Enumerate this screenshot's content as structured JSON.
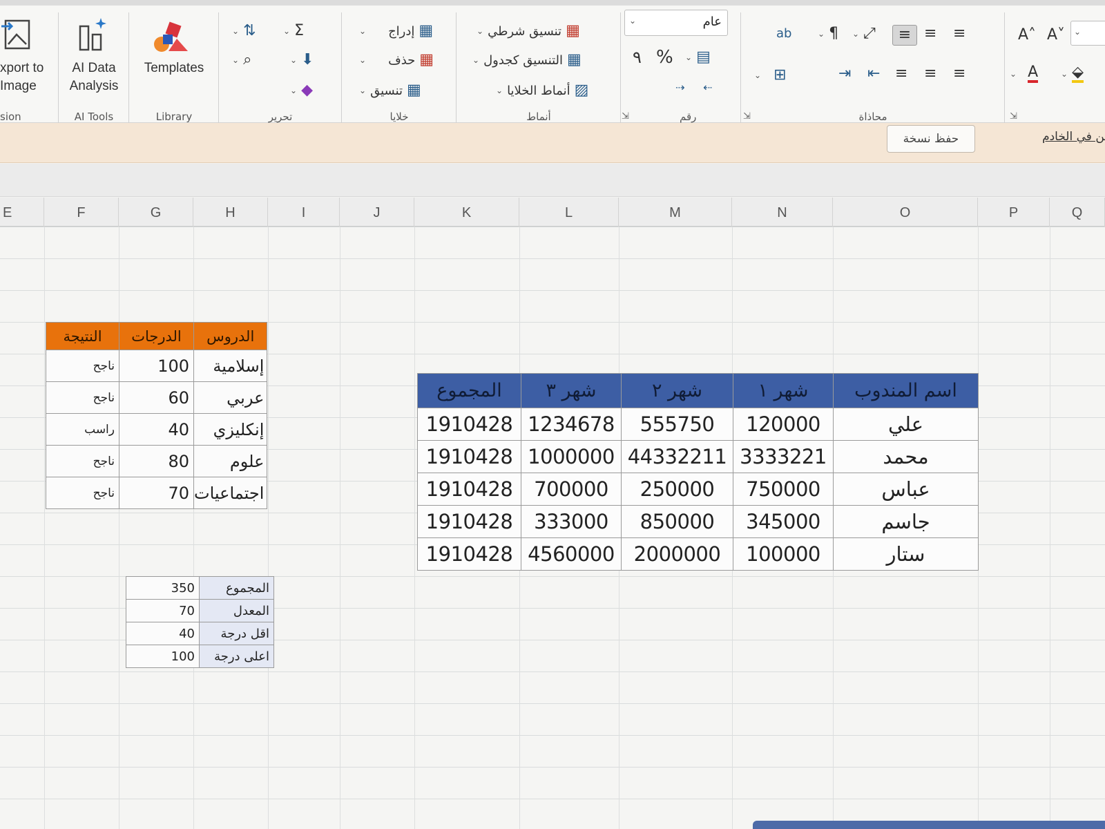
{
  "ribbon": {
    "export": {
      "label_line1": "xport to",
      "label_line2": "Image",
      "group": "sion"
    },
    "ai": {
      "label_line1": "AI Data",
      "label_line2": "Analysis",
      "group": "AI Tools"
    },
    "library": {
      "label": "Templates",
      "group": "Library"
    },
    "editing": {
      "group": "تحرير"
    },
    "cells": {
      "group": "خلايا",
      "insert": "إدراج",
      "delete": "حذف",
      "format": "تنسيق"
    },
    "styles": {
      "group": "أنماط",
      "conditional": "تنسيق شرطي",
      "as_table": "التنسيق كجدول",
      "cell_styles": "أنماط الخلايا"
    },
    "number": {
      "group": "رقم",
      "format_value": "عام",
      "percent": "%",
      "comma": "٩"
    },
    "alignment": {
      "group": "محاذاة"
    }
  },
  "infobar": {
    "save_copy": "حفظ نسخة",
    "text": "ة للتخزين في الخادم."
  },
  "columns": [
    "E",
    "F",
    "G",
    "H",
    "I",
    "J",
    "K",
    "L",
    "M",
    "N",
    "O",
    "P",
    "Q"
  ],
  "grades_table": {
    "headers": {
      "subject": "الدروس",
      "grade": "الدرجات",
      "result": "النتيجة"
    },
    "rows": [
      {
        "subject": "إسلامية",
        "grade": "100",
        "result": "ناجح"
      },
      {
        "subject": "عربي",
        "grade": "60",
        "result": "ناجح"
      },
      {
        "subject": "إنكليزي",
        "grade": "40",
        "result": "راسب"
      },
      {
        "subject": "علوم",
        "grade": "80",
        "result": "ناجح"
      },
      {
        "subject": "اجتماعيات",
        "grade": "70",
        "result": "ناجح"
      }
    ]
  },
  "stats_table": {
    "rows": [
      {
        "label": "المجموع",
        "value": "350"
      },
      {
        "label": "المعدل",
        "value": "70"
      },
      {
        "label": "اقل درجة",
        "value": "40"
      },
      {
        "label": "اعلى درجة",
        "value": "100"
      }
    ]
  },
  "sales_table": {
    "headers": {
      "name": "اسم المندوب",
      "m1": "شهر ١",
      "m2": "شهر ٢",
      "m3": "شهر ٣",
      "total": "المجموع"
    },
    "rows": [
      {
        "name": "علي",
        "m1": "120000",
        "m2": "555750",
        "m3": "1234678",
        "total": "1910428"
      },
      {
        "name": "محمد",
        "m1": "3333221",
        "m2": "44332211",
        "m3": "1000000",
        "total": "1910428"
      },
      {
        "name": "عباس",
        "m1": "750000",
        "m2": "250000",
        "m3": "700000",
        "total": "1910428"
      },
      {
        "name": "جاسم",
        "m1": "345000",
        "m2": "850000",
        "m3": "333000",
        "total": "1910428"
      },
      {
        "name": "ستار",
        "m1": "100000",
        "m2": "2000000",
        "m3": "4560000",
        "total": "1910428"
      }
    ]
  },
  "colors": {
    "grades_header": "#e8720c",
    "sales_header": "#3d5ea4",
    "stats_label_bg": "#e4e8f4",
    "infobar_bg": "#f5e6d5"
  }
}
